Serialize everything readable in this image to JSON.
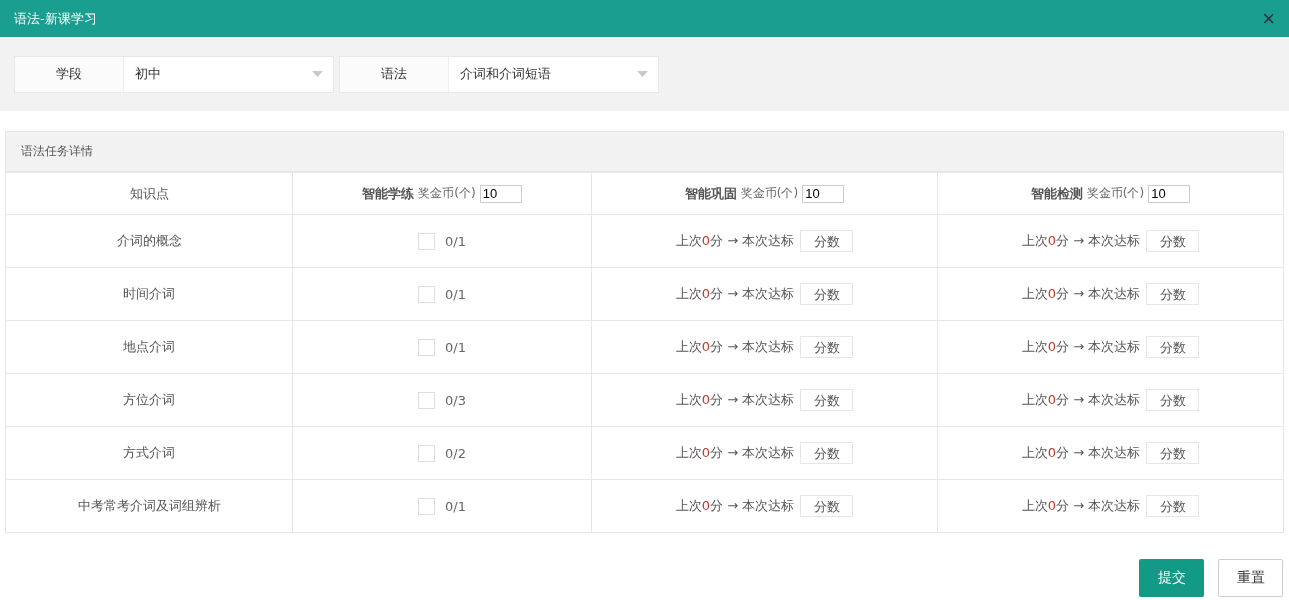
{
  "window": {
    "title": "语法-新课学习",
    "close": "×"
  },
  "filters": [
    {
      "label": "学段",
      "value": "初中"
    },
    {
      "label": "语法",
      "value": "介词和介词短语"
    }
  ],
  "section_title": "语法任务详情",
  "columns": [
    {
      "kind": "plain",
      "title": "知识点"
    },
    {
      "kind": "reward",
      "title": "智能学练",
      "reward_label": "奖金币(个)",
      "reward_value": "10"
    },
    {
      "kind": "reward",
      "title": "智能巩固",
      "reward_label": "奖金币(个)",
      "reward_value": "10"
    },
    {
      "kind": "reward",
      "title": "智能检测",
      "reward_label": "奖金币(个)",
      "reward_value": "10"
    }
  ],
  "rows": [
    {
      "topic": "介词的概念",
      "checked": false,
      "progress": "0/1",
      "consolidate": {
        "prefix": "上次",
        "score": "0",
        "suffix": "分 → 本次达标",
        "placeholder": "分数"
      },
      "test": {
        "prefix": "上次",
        "score": "0",
        "suffix": "分 → 本次达标",
        "placeholder": "分数"
      }
    },
    {
      "topic": "时间介词",
      "checked": false,
      "progress": "0/1",
      "consolidate": {
        "prefix": "上次",
        "score": "0",
        "suffix": "分 → 本次达标",
        "placeholder": "分数"
      },
      "test": {
        "prefix": "上次",
        "score": "0",
        "suffix": "分 → 本次达标",
        "placeholder": "分数"
      }
    },
    {
      "topic": "地点介词",
      "checked": false,
      "progress": "0/1",
      "consolidate": {
        "prefix": "上次",
        "score": "0",
        "suffix": "分 → 本次达标",
        "placeholder": "分数"
      },
      "test": {
        "prefix": "上次",
        "score": "0",
        "suffix": "分 → 本次达标",
        "placeholder": "分数"
      }
    },
    {
      "topic": "方位介词",
      "checked": false,
      "progress": "0/3",
      "consolidate": {
        "prefix": "上次",
        "score": "0",
        "suffix": "分 → 本次达标",
        "placeholder": "分数"
      },
      "test": {
        "prefix": "上次",
        "score": "0",
        "suffix": "分 → 本次达标",
        "placeholder": "分数"
      }
    },
    {
      "topic": "方式介词",
      "checked": false,
      "progress": "0/2",
      "consolidate": {
        "prefix": "上次",
        "score": "0",
        "suffix": "分 → 本次达标",
        "placeholder": "分数"
      },
      "test": {
        "prefix": "上次",
        "score": "0",
        "suffix": "分 → 本次达标",
        "placeholder": "分数"
      }
    },
    {
      "topic": "中考常考介词及词组辨析",
      "checked": false,
      "progress": "0/1",
      "consolidate": {
        "prefix": "上次",
        "score": "0",
        "suffix": "分 → 本次达标",
        "placeholder": "分数"
      },
      "test": {
        "prefix": "上次",
        "score": "0",
        "suffix": "分 → 本次达标",
        "placeholder": "分数"
      }
    }
  ],
  "buttons": [
    {
      "kind": "primary",
      "label": "提交"
    },
    {
      "kind": "default",
      "label": "重置"
    }
  ]
}
